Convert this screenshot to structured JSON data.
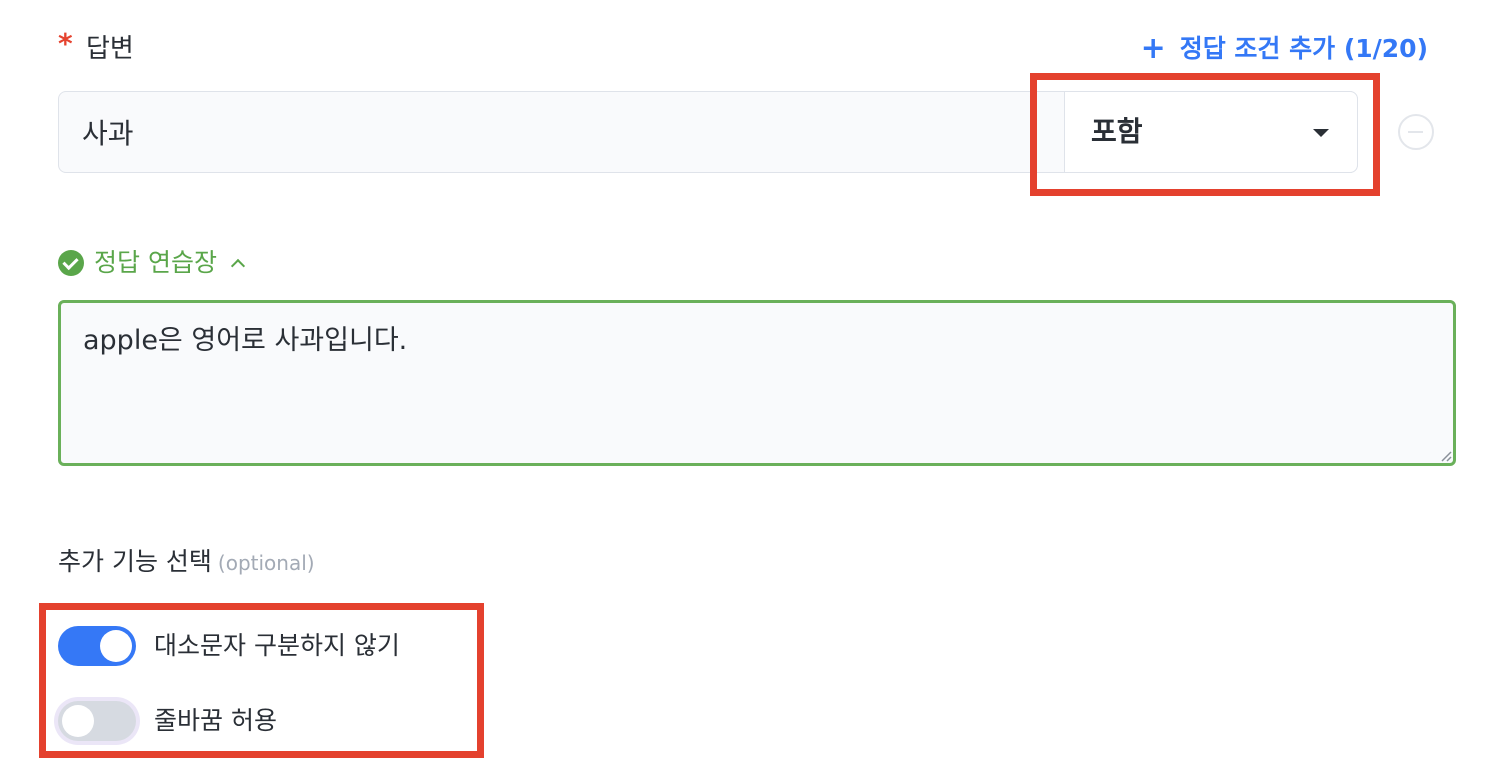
{
  "answer_field": {
    "required_mark": "*",
    "label": "답변",
    "add_condition_label": "정답 조건 추가 (1/20)",
    "value": "사과",
    "match_type": "포함"
  },
  "practice": {
    "label": "정답 연습장",
    "text": "apple은 영어로 사과입니다."
  },
  "extra_options": {
    "label": "추가 기능 선택",
    "optional_tag": "(optional)",
    "toggles": [
      {
        "label": "대소문자 구분하지 않기",
        "on": true
      },
      {
        "label": "줄바꿈 허용",
        "on": false
      }
    ]
  },
  "colors": {
    "accent": "#3478f6",
    "success": "#5aa64a",
    "required": "#e5432f",
    "highlight": "#e4412e"
  },
  "icons": [
    "plus-icon",
    "caret-down-icon",
    "minus-circle-icon",
    "check-circle-icon",
    "chevron-up-icon"
  ]
}
